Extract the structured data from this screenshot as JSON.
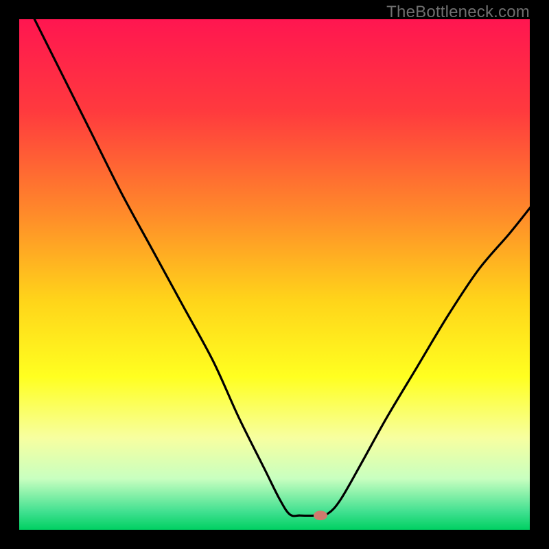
{
  "watermark": "TheBottleneck.com",
  "chart_data": {
    "type": "line",
    "title": "",
    "xlabel": "",
    "ylabel": "",
    "xlim": [
      0,
      100
    ],
    "ylim": [
      0,
      100
    ],
    "background_gradient_stops": [
      {
        "offset": 0.0,
        "color": "#ff1650"
      },
      {
        "offset": 0.18,
        "color": "#ff3a3e"
      },
      {
        "offset": 0.38,
        "color": "#ff8a2a"
      },
      {
        "offset": 0.55,
        "color": "#ffd41a"
      },
      {
        "offset": 0.7,
        "color": "#ffff20"
      },
      {
        "offset": 0.82,
        "color": "#f7ffa0"
      },
      {
        "offset": 0.9,
        "color": "#c8ffc0"
      },
      {
        "offset": 0.965,
        "color": "#40e090"
      },
      {
        "offset": 1.0,
        "color": "#00d062"
      }
    ],
    "curve_points_pct": [
      {
        "x": 3.0,
        "y": 100.0
      },
      {
        "x": 8.0,
        "y": 90.0
      },
      {
        "x": 14.0,
        "y": 78.0
      },
      {
        "x": 20.0,
        "y": 66.0
      },
      {
        "x": 26.0,
        "y": 55.0
      },
      {
        "x": 32.0,
        "y": 44.0
      },
      {
        "x": 38.0,
        "y": 33.0
      },
      {
        "x": 43.0,
        "y": 22.0
      },
      {
        "x": 48.0,
        "y": 12.0
      },
      {
        "x": 51.0,
        "y": 6.0
      },
      {
        "x": 53.0,
        "y": 3.0
      },
      {
        "x": 55.0,
        "y": 2.8
      },
      {
        "x": 58.0,
        "y": 2.8
      },
      {
        "x": 60.5,
        "y": 3.2
      },
      {
        "x": 63.0,
        "y": 6.0
      },
      {
        "x": 67.0,
        "y": 13.0
      },
      {
        "x": 72.0,
        "y": 22.0
      },
      {
        "x": 78.0,
        "y": 32.0
      },
      {
        "x": 84.0,
        "y": 42.0
      },
      {
        "x": 90.0,
        "y": 51.0
      },
      {
        "x": 96.0,
        "y": 58.0
      },
      {
        "x": 100.0,
        "y": 63.0
      }
    ],
    "marker": {
      "x_pct": 59.0,
      "y_pct": 2.8,
      "color": "#cf7a6d"
    }
  }
}
